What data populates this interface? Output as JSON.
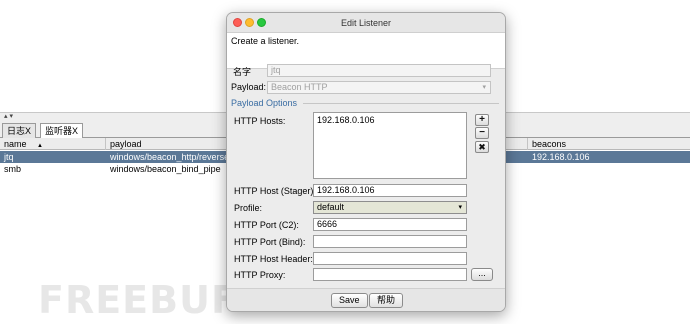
{
  "background": {
    "splitter_arrows": "▴ ▾",
    "tabs": [
      {
        "label": "日志X",
        "active": false
      },
      {
        "label": "监听器X",
        "active": true
      }
    ],
    "table": {
      "columns": [
        "name",
        "payload",
        "beacons"
      ],
      "sort_indicator": "▲",
      "rows": [
        {
          "name": "jtq",
          "payload": "windows/beacon_http/reverse_http",
          "beacons": "192.168.0.106",
          "selected": true
        },
        {
          "name": "smb",
          "payload": "windows/beacon_bind_pipe",
          "beacons": "",
          "selected": false
        }
      ]
    },
    "watermark": "FREEBUF"
  },
  "dialog": {
    "title": "Edit Listener",
    "description": "Create a listener.",
    "name_label": "名字",
    "name_value": "jtq",
    "payload_label": "Payload:",
    "payload_value": "Beacon HTTP",
    "section_title": "Payload Options",
    "http_hosts_label": "HTTP Hosts:",
    "http_hosts": [
      "192.168.0.106"
    ],
    "host_buttons": {
      "add": "+",
      "remove": "−",
      "clear": "✖"
    },
    "stager_label": "HTTP Host (Stager):",
    "stager_value": "192.168.0.106",
    "profile_label": "Profile:",
    "profile_value": "default",
    "port_c2_label": "HTTP Port (C2):",
    "port_c2_value": "6666",
    "port_bind_label": "HTTP Port (Bind):",
    "port_bind_value": "",
    "host_header_label": "HTTP Host Header:",
    "host_header_value": "",
    "proxy_label": "HTTP Proxy:",
    "proxy_value": "",
    "proxy_button": "...",
    "save_label": "Save",
    "help_label": "帮助"
  },
  "colors": {
    "selected_row": "#5b7897",
    "section_title": "#3a6da3",
    "close": "#fe5f57",
    "minimize": "#febc2e",
    "zoom": "#28c840",
    "profile_combo": "#e4e6d6"
  }
}
